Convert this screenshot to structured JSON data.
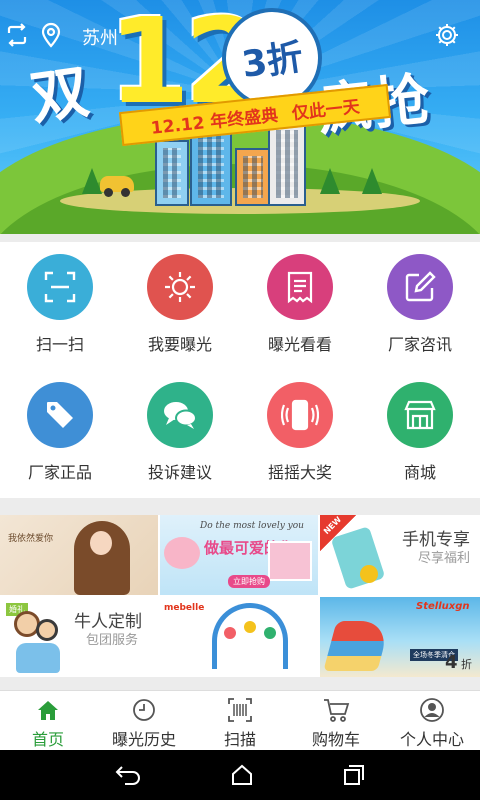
{
  "banner": {
    "city": "苏州",
    "title_left": "双",
    "title_number": "12",
    "badge": "3折",
    "title_right": "疯抢",
    "ribbon_left": "12.12 年终盛典",
    "ribbon_right": "仅此一天"
  },
  "grid": {
    "items": [
      {
        "label": "扫一扫",
        "icon": "scan-icon",
        "color": "#3aaed8"
      },
      {
        "label": "我要曝光",
        "icon": "sun-icon",
        "color": "#e0534f"
      },
      {
        "label": "曝光看看",
        "icon": "receipt-icon",
        "color": "#d83f7c"
      },
      {
        "label": "厂家咨讯",
        "icon": "edit-icon",
        "color": "#8e58c6"
      },
      {
        "label": "厂家正品",
        "icon": "tag-icon",
        "color": "#3f8fd6"
      },
      {
        "label": "投诉建议",
        "icon": "chat-icon",
        "color": "#2fb28a"
      },
      {
        "label": "摇摇大奖",
        "icon": "shake-phone-icon",
        "color": "#f25f66"
      },
      {
        "label": "商城",
        "icon": "store-icon",
        "color": "#2fb16e"
      }
    ]
  },
  "promo": {
    "tile1_text": "我依然爱你",
    "tile2_phrase": "Do the most lovely you",
    "tile2_title": "做最可爱的你",
    "tile2_button": "立即抢购",
    "tile3_new": "NEW",
    "tile3_title": "手机专享",
    "tile3_sub": "尽享福利",
    "tile4_tag": "婚礼",
    "tile4_title": "牛人定制",
    "tile4_sub": "包团服务",
    "tile5_brand": "mebelle",
    "tile6_brand": "Stelluxgn",
    "tile6_caption": "全场冬季清仓",
    "tile6_discount_number": "4",
    "tile6_discount_unit": "折"
  },
  "tabs": [
    {
      "label": "首页",
      "icon": "home-icon",
      "active": true
    },
    {
      "label": "曝光历史",
      "icon": "clock-icon",
      "active": false
    },
    {
      "label": "扫描",
      "icon": "barcode-scan-icon",
      "active": false
    },
    {
      "label": "购物车",
      "icon": "cart-icon",
      "active": false
    },
    {
      "label": "个人中心",
      "icon": "user-icon",
      "active": false
    }
  ],
  "colors": {
    "accent": "#2a9d3a",
    "banner_blue": "#1e8fe6"
  }
}
